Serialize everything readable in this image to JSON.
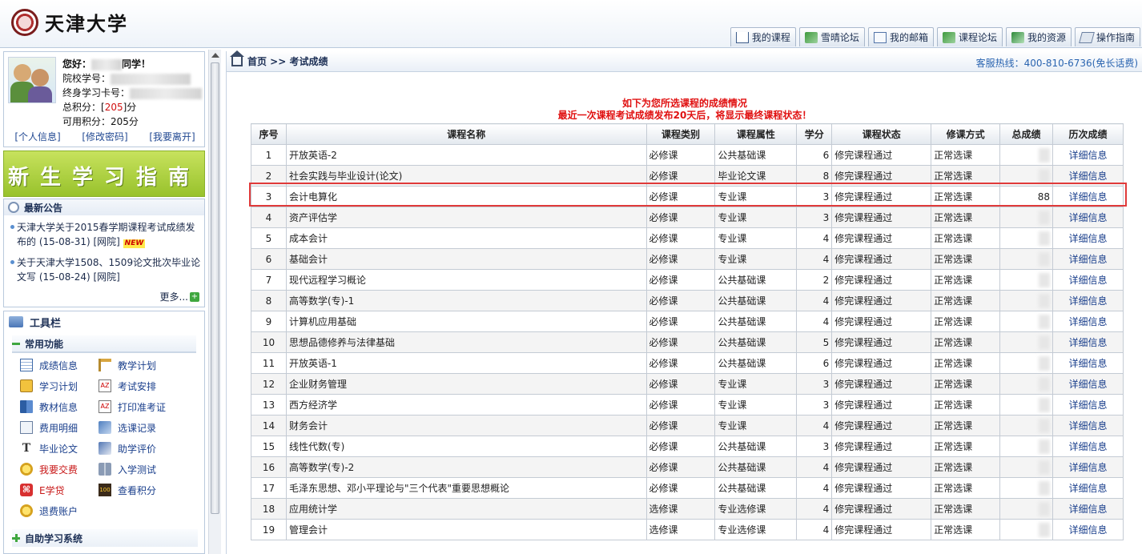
{
  "header": {
    "school_name": "天津大学",
    "nav": [
      {
        "label": "我的课程",
        "icon": "home-icon"
      },
      {
        "label": "雪晴论坛",
        "icon": "forum-icon"
      },
      {
        "label": "我的邮箱",
        "icon": "mail-icon"
      },
      {
        "label": "课程论坛",
        "icon": "forum-icon"
      },
      {
        "label": "我的资源",
        "icon": "resource-icon"
      },
      {
        "label": "操作指南",
        "icon": "guide-icon"
      }
    ]
  },
  "user": {
    "greeting_prefix": "您好：",
    "greeting_suffix": "同学！",
    "student_id_label": "院校学号：",
    "card_label": "终身学习卡号：",
    "total_points_label": "总积分：[",
    "total_points": "205",
    "total_points_suffix": "]分",
    "avail_points_label": "可用积分：205分",
    "links": [
      "[个人信息]",
      "[修改密码]",
      "[我要离开]"
    ]
  },
  "banner": {
    "text": "新生学习指南"
  },
  "announcements": {
    "title": "最新公告",
    "items": [
      {
        "text": "天津大学关于2015春学期课程考试成绩发布的 (15-08-31) [网院]",
        "badge": "NEW"
      },
      {
        "text": "关于天津大学1508、1509论文批次毕业论文写 (15-08-24) [网院]",
        "badge": ""
      }
    ],
    "more": "更多..."
  },
  "toolbar": {
    "title": "工具栏",
    "section": "常用功能",
    "tools": [
      {
        "label": "成绩信息",
        "icon": "grid-icon"
      },
      {
        "label": "教学计划",
        "icon": "plan-icon"
      },
      {
        "label": "学习计划",
        "icon": "study-plan-icon"
      },
      {
        "label": "考试安排",
        "icon": "exam-icon"
      },
      {
        "label": "教材信息",
        "icon": "book-icon"
      },
      {
        "label": "打印准考证",
        "icon": "print-icon"
      },
      {
        "label": "费用明细",
        "icon": "fee-icon"
      },
      {
        "label": "选课记录",
        "icon": "record-icon"
      },
      {
        "label": "毕业论文",
        "icon": "thesis-icon"
      },
      {
        "label": "助学评价",
        "icon": "eval-icon"
      },
      {
        "label": "我要交费",
        "icon": "coin-icon"
      },
      {
        "label": "入学测试",
        "icon": "test-icon"
      },
      {
        "label": "E学贷",
        "icon": "eloan-icon"
      },
      {
        "label": "查看积分",
        "icon": "points-icon"
      },
      {
        "label": "退费账户",
        "icon": "refund-icon"
      }
    ],
    "self_study": "自助学习系统"
  },
  "main": {
    "breadcrumb": "首页 >> 考试成绩",
    "hotline": "客服热线：400-810-6736(免长话费)",
    "notice_line1": "如下为您所选课程的成绩情况",
    "notice_line2": "最近一次课程考试成绩发布20天后，将显示最终课程状态！",
    "columns": [
      "序号",
      "课程名称",
      "课程类别",
      "课程属性",
      "学分",
      "课程状态",
      "修课方式",
      "总成绩",
      "历次成绩"
    ],
    "rows": [
      {
        "no": "1",
        "name": "开放英语-2",
        "cat": "必修课",
        "attr": "公共基础课",
        "credit": "6",
        "status": "修完课程通过",
        "mode": "正常选课",
        "score": "",
        "detail": "详细信息"
      },
      {
        "no": "2",
        "name": "社会实践与毕业设计(论文)",
        "cat": "必修课",
        "attr": "毕业论文课",
        "credit": "8",
        "status": "修完课程通过",
        "mode": "正常选课",
        "score": "",
        "detail": "详细信息"
      },
      {
        "no": "3",
        "name": "会计电算化",
        "cat": "必修课",
        "attr": "专业课",
        "credit": "3",
        "status": "修完课程通过",
        "mode": "正常选课",
        "score": "88",
        "detail": "详细信息"
      },
      {
        "no": "4",
        "name": "资产评估学",
        "cat": "必修课",
        "attr": "专业课",
        "credit": "3",
        "status": "修完课程通过",
        "mode": "正常选课",
        "score": "",
        "detail": "详细信息"
      },
      {
        "no": "5",
        "name": "成本会计",
        "cat": "必修课",
        "attr": "专业课",
        "credit": "4",
        "status": "修完课程通过",
        "mode": "正常选课",
        "score": "",
        "detail": "详细信息"
      },
      {
        "no": "6",
        "name": "基础会计",
        "cat": "必修课",
        "attr": "专业课",
        "credit": "4",
        "status": "修完课程通过",
        "mode": "正常选课",
        "score": "",
        "detail": "详细信息"
      },
      {
        "no": "7",
        "name": "现代远程学习概论",
        "cat": "必修课",
        "attr": "公共基础课",
        "credit": "2",
        "status": "修完课程通过",
        "mode": "正常选课",
        "score": "",
        "detail": "详细信息"
      },
      {
        "no": "8",
        "name": "高等数学(专)-1",
        "cat": "必修课",
        "attr": "公共基础课",
        "credit": "4",
        "status": "修完课程通过",
        "mode": "正常选课",
        "score": "",
        "detail": "详细信息"
      },
      {
        "no": "9",
        "name": "计算机应用基础",
        "cat": "必修课",
        "attr": "公共基础课",
        "credit": "4",
        "status": "修完课程通过",
        "mode": "正常选课",
        "score": "",
        "detail": "详细信息"
      },
      {
        "no": "10",
        "name": "思想品德修养与法律基础",
        "cat": "必修课",
        "attr": "公共基础课",
        "credit": "5",
        "status": "修完课程通过",
        "mode": "正常选课",
        "score": "",
        "detail": "详细信息"
      },
      {
        "no": "11",
        "name": "开放英语-1",
        "cat": "必修课",
        "attr": "公共基础课",
        "credit": "6",
        "status": "修完课程通过",
        "mode": "正常选课",
        "score": "",
        "detail": "详细信息"
      },
      {
        "no": "12",
        "name": "企业财务管理",
        "cat": "必修课",
        "attr": "专业课",
        "credit": "3",
        "status": "修完课程通过",
        "mode": "正常选课",
        "score": "",
        "detail": "详细信息"
      },
      {
        "no": "13",
        "name": "西方经济学",
        "cat": "必修课",
        "attr": "专业课",
        "credit": "3",
        "status": "修完课程通过",
        "mode": "正常选课",
        "score": "",
        "detail": "详细信息"
      },
      {
        "no": "14",
        "name": "财务会计",
        "cat": "必修课",
        "attr": "专业课",
        "credit": "4",
        "status": "修完课程通过",
        "mode": "正常选课",
        "score": "",
        "detail": "详细信息"
      },
      {
        "no": "15",
        "name": "线性代数(专)",
        "cat": "必修课",
        "attr": "公共基础课",
        "credit": "3",
        "status": "修完课程通过",
        "mode": "正常选课",
        "score": "",
        "detail": "详细信息"
      },
      {
        "no": "16",
        "name": "高等数学(专)-2",
        "cat": "必修课",
        "attr": "公共基础课",
        "credit": "4",
        "status": "修完课程通过",
        "mode": "正常选课",
        "score": "",
        "detail": "详细信息"
      },
      {
        "no": "17",
        "name": "毛泽东思想、邓小平理论与\"三个代表\"重要思想概论",
        "cat": "必修课",
        "attr": "公共基础课",
        "credit": "4",
        "status": "修完课程通过",
        "mode": "正常选课",
        "score": "",
        "detail": "详细信息"
      },
      {
        "no": "18",
        "name": "应用统计学",
        "cat": "选修课",
        "attr": "专业选修课",
        "credit": "4",
        "status": "修完课程通过",
        "mode": "正常选课",
        "score": "",
        "detail": "详细信息"
      },
      {
        "no": "19",
        "name": "管理会计",
        "cat": "选修课",
        "attr": "专业选修课",
        "credit": "4",
        "status": "修完课程通过",
        "mode": "正常选课",
        "score": "",
        "detail": "详细信息"
      }
    ]
  }
}
